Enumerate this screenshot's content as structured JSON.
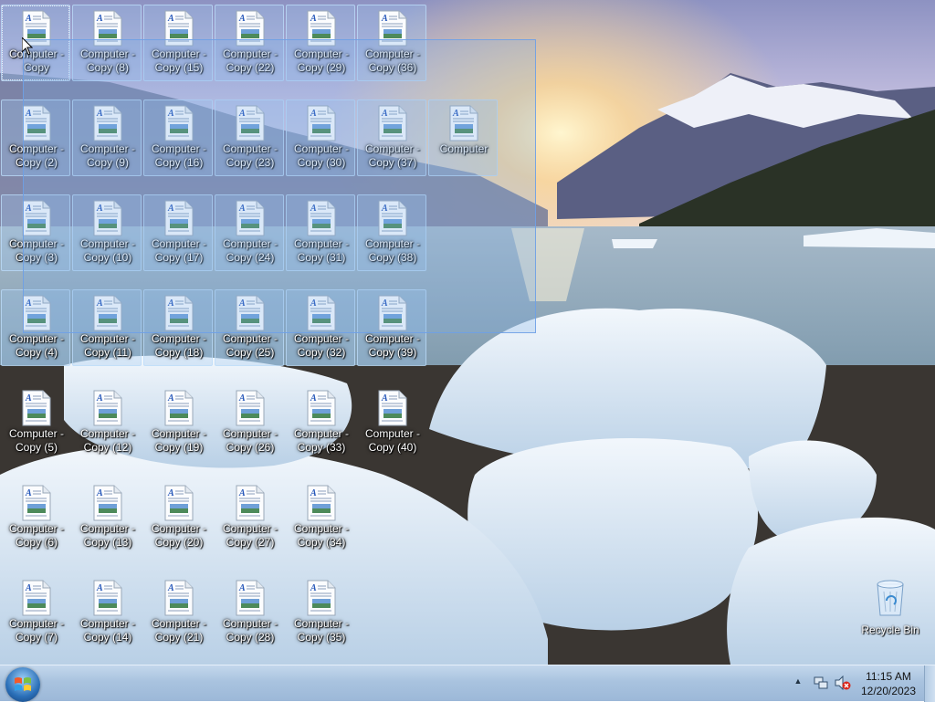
{
  "desktop": {
    "icons": [
      {
        "label": "Computer -\nCopy",
        "selected": true,
        "focused": true
      },
      {
        "label": "Computer -\nCopy (2)",
        "selected": true
      },
      {
        "label": "Computer -\nCopy (3)",
        "selected": true
      },
      {
        "label": "Computer -\nCopy (4)",
        "selected": true
      },
      {
        "label": "Computer -\nCopy (5)",
        "selected": false
      },
      {
        "label": "Computer -\nCopy (6)",
        "selected": false
      },
      {
        "label": "Computer -\nCopy (7)",
        "selected": false
      },
      {
        "label": "Computer -\nCopy (8)",
        "selected": true
      },
      {
        "label": "Computer -\nCopy (9)",
        "selected": true
      },
      {
        "label": "Computer -\nCopy (10)",
        "selected": true
      },
      {
        "label": "Computer -\nCopy (11)",
        "selected": true
      },
      {
        "label": "Computer -\nCopy (12)",
        "selected": false
      },
      {
        "label": "Computer -\nCopy (13)",
        "selected": false
      },
      {
        "label": "Computer -\nCopy (14)",
        "selected": false
      },
      {
        "label": "Computer -\nCopy (15)",
        "selected": true
      },
      {
        "label": "Computer -\nCopy (16)",
        "selected": true
      },
      {
        "label": "Computer -\nCopy (17)",
        "selected": true
      },
      {
        "label": "Computer -\nCopy (18)",
        "selected": true
      },
      {
        "label": "Computer -\nCopy (19)",
        "selected": false
      },
      {
        "label": "Computer -\nCopy (20)",
        "selected": false
      },
      {
        "label": "Computer -\nCopy (21)",
        "selected": false
      },
      {
        "label": "Computer -\nCopy (22)",
        "selected": true
      },
      {
        "label": "Computer -\nCopy (23)",
        "selected": true
      },
      {
        "label": "Computer -\nCopy (24)",
        "selected": true
      },
      {
        "label": "Computer -\nCopy (25)",
        "selected": true
      },
      {
        "label": "Computer -\nCopy (26)",
        "selected": false
      },
      {
        "label": "Computer -\nCopy (27)",
        "selected": false
      },
      {
        "label": "Computer -\nCopy (28)",
        "selected": false
      },
      {
        "label": "Computer -\nCopy (29)",
        "selected": true
      },
      {
        "label": "Computer -\nCopy (30)",
        "selected": true
      },
      {
        "label": "Computer -\nCopy (31)",
        "selected": true
      },
      {
        "label": "Computer -\nCopy (32)",
        "selected": true
      },
      {
        "label": "Computer -\nCopy (33)",
        "selected": false
      },
      {
        "label": "Computer -\nCopy (34)",
        "selected": false
      },
      {
        "label": "Computer -\nCopy (35)",
        "selected": false
      },
      {
        "label": "Computer -\nCopy (36)",
        "selected": true
      },
      {
        "label": "Computer -\nCopy (37)",
        "selected": true
      },
      {
        "label": "Computer -\nCopy (38)",
        "selected": true
      },
      {
        "label": "Computer -\nCopy (39)",
        "selected": true
      },
      {
        "label": "Computer -\nCopy (40)",
        "selected": false
      },
      {
        "label": "Computer",
        "selected": true
      }
    ],
    "recycle_bin": {
      "label": "Recycle Bin",
      "icon": "recycle-bin-icon"
    }
  },
  "taskbar": {
    "start_icon": "windows-logo-icon",
    "tray": {
      "show_hidden_icon": "chevron-up-icon",
      "network_icon": "network-icon",
      "volume_icon": "volume-muted-icon"
    },
    "clock": {
      "time": "11:15 AM",
      "date": "12/20/2023"
    }
  },
  "colors": {
    "selection_fill": "#78aae6",
    "taskbar": "#a9c3df"
  }
}
